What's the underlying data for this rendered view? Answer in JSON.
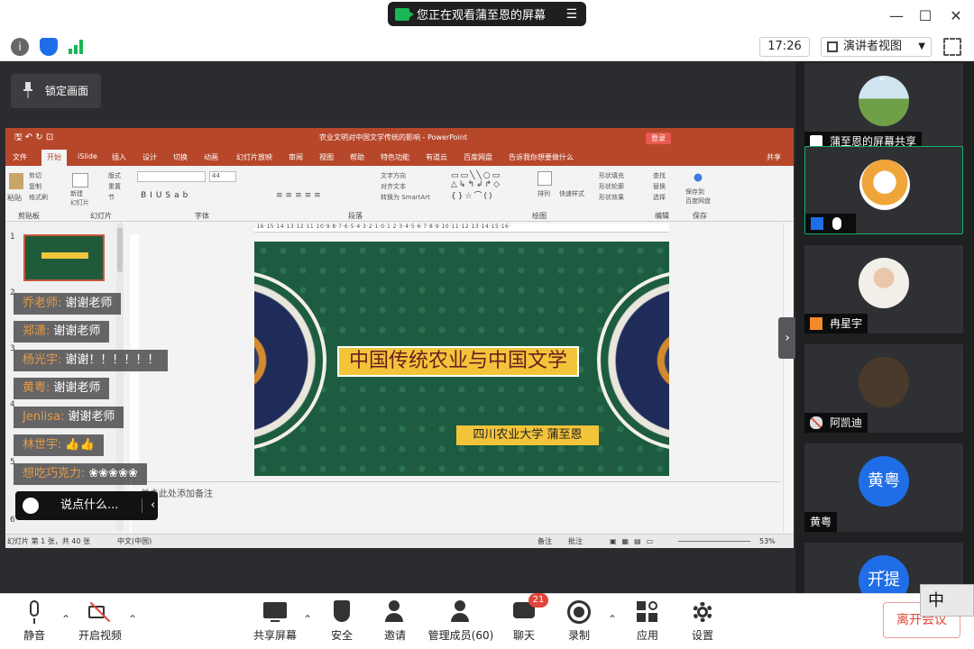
{
  "share_banner": {
    "text": "您正在观看蒲至恩的屏幕",
    "menu_icon": "menu-icon"
  },
  "toolbar": {
    "clock": "17:26",
    "view_mode": "演讲者视图"
  },
  "lock_button": "锁定画面",
  "ppt": {
    "title": "农业文明对中国文学传统的影响 - PowerPoint",
    "login": "登录",
    "share": "共享",
    "tell_me": "告诉我你想要做什么",
    "tabs": [
      "文件",
      "开始",
      "iSlide",
      "插入",
      "设计",
      "切换",
      "动画",
      "幻灯片放映",
      "审阅",
      "视图",
      "帮助",
      "特色功能",
      "有道云",
      "百度网盘"
    ],
    "groups": [
      "剪贴板",
      "幻灯片",
      "字体",
      "段落",
      "绘图",
      "编辑",
      "保存"
    ],
    "ribbon_labels": {
      "paste": "粘贴",
      "new_slide": "新建\n幻灯片",
      "layout": "版式",
      "reset": "重置",
      "section": "节",
      "cut": "剪切",
      "copy": "复制",
      "format_painter": "格式刷",
      "font_size": "44",
      "text_direction": "文字方向",
      "align_text": "对齐文本",
      "smartart": "转换为 SmartArt",
      "arrange": "排列",
      "quick_styles": "快速样式",
      "shape_fill": "形状填充",
      "shape_outline": "形状轮廓",
      "shape_effects": "形状效果",
      "find": "查找",
      "replace": "替换",
      "select": "选择",
      "save_to": "保存到\n百度网盘"
    },
    "ruler": "·16·15·14·13·12·11·10·9·8·7·6·5·4·3·2·1·0·1·2·3·4·5·6·7·8·9·10·11·12·13·14·15·16·",
    "slide_title": "中国传统农业与中国文学",
    "slide_subtitle": "四川农业大学  蒲至恩",
    "notes_placeholder": "单击此处添加备注",
    "status_left": "幻灯片 第 1 张，共 40 张",
    "status_lang": "中文(中国)",
    "status_notes": "备注",
    "status_comments": "批注",
    "zoom": "53%",
    "thumb_numbers": [
      "1",
      "2",
      "3",
      "4",
      "5",
      "6"
    ]
  },
  "chat": [
    {
      "name": "乔老师:",
      "text": "谢谢老师"
    },
    {
      "name": "郑潇:",
      "text": "谢谢老师"
    },
    {
      "name": "杨光宇:",
      "text": "谢谢！！！！！！"
    },
    {
      "name": "黄粤:",
      "text": "谢谢老师"
    },
    {
      "name": "Jenlisa:",
      "text": "谢谢老师"
    },
    {
      "name": "林世宇:",
      "text": "👍👍"
    },
    {
      "name": "想吃巧克力:",
      "text": "❀❀❀❀❀"
    }
  ],
  "say_box": "说点什么...",
  "participants": [
    {
      "name": "蒲至恩的屏幕共享"
    },
    {
      "name": ""
    },
    {
      "name": "冉星宇"
    },
    {
      "name": "阿凯迪"
    },
    {
      "name": "黄粤",
      "avatar_text": "黄粤"
    },
    {
      "name": "",
      "avatar_text": "开提"
    }
  ],
  "bottom": {
    "mute": "静音",
    "video": "开启视频",
    "share": "共享屏幕",
    "security": "安全",
    "invite": "邀请",
    "members": "管理成员(60)",
    "chat": "聊天",
    "chat_badge": "21",
    "record": "录制",
    "apps": "应用",
    "settings": "设置",
    "leave": "离开会议"
  },
  "ime": "中",
  "colors": {
    "ppt_accent": "#b7472a",
    "zoom_green": "#19b755",
    "active_border": "#1aae6a",
    "leave_red": "#e0463a",
    "avatar_blue": "#1f6ee8"
  }
}
